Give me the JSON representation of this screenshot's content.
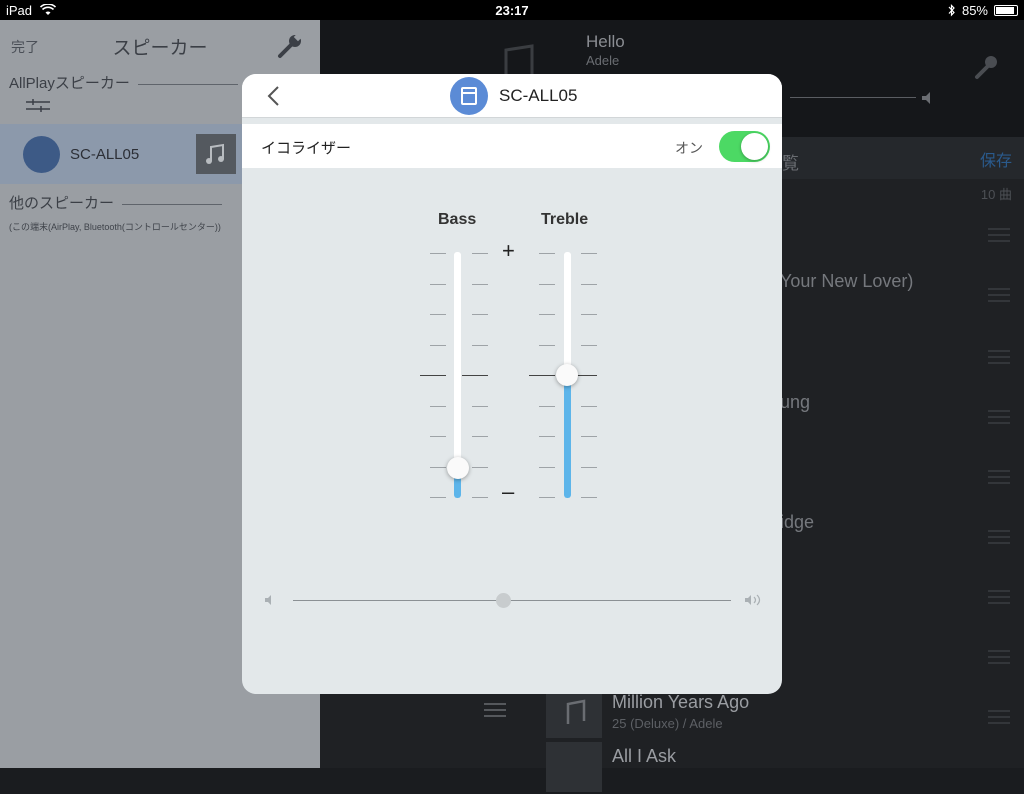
{
  "status": {
    "device": "iPad",
    "time": "23:17",
    "battery": "85%"
  },
  "left": {
    "done": "完了",
    "title": "スピーカー",
    "allplay_section": "AllPlayスピーカー",
    "speaker_name": "SC-ALL05",
    "other_section": "他のスピーカー",
    "other_sub": "(この端末(AirPlay, Bluetooth(コントロールセンター))"
  },
  "right": {
    "song": "Hello",
    "artist": "Adele",
    "queue_label": "覧",
    "save_label": "保存",
    "count_label": "10 曲",
    "tracks": [
      "Your New Lover)",
      "ung",
      "idge"
    ],
    "bottom_rows": [
      {
        "title": "Million Years Ago",
        "sub": "25 (Deluxe) / Adele"
      },
      {
        "title": "All I Ask",
        "sub": ""
      }
    ]
  },
  "modal": {
    "title": "SC-ALL05",
    "equalizer_label": "イコライザー",
    "equalizer_state": "オン",
    "equalizer_on": true,
    "bass_label": "Bass",
    "treble_label": "Treble",
    "plus": "+",
    "minus": "–",
    "bass_level": 0.12,
    "treble_level": 0.5,
    "volume_level": 0.48
  },
  "colors": {
    "accent_blue": "#5db5ea",
    "toggle_green": "#4cd964",
    "icon_blue": "#5b8bd6"
  }
}
